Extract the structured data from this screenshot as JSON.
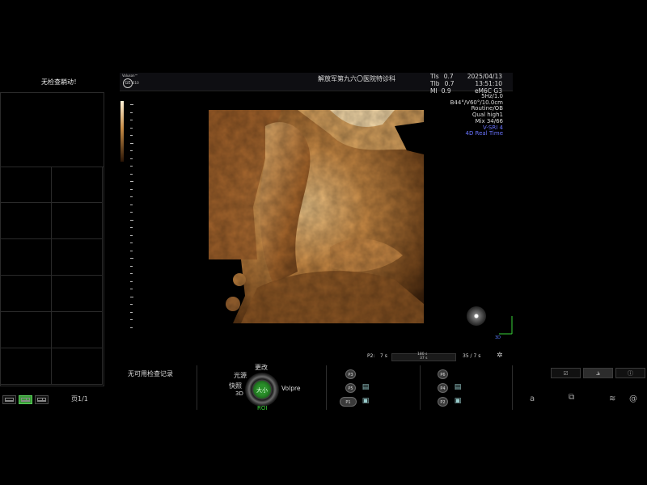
{
  "left_panel": {
    "title": "无检查耥动！",
    "page": "页1/1"
  },
  "header": {
    "brand_line": "Voluson™",
    "model_line": "E10",
    "ge_mark": "GE",
    "hospital": "解放军第九六〇医院特诊科",
    "safety": [
      {
        "label": "TIs",
        "value": "0.7"
      },
      {
        "label": "TIb",
        "value": "0.7"
      },
      {
        "label": "MI",
        "value": "0.9"
      }
    ],
    "date": "2025/04/13",
    "time": "13:51:10",
    "probe": "eM6C G3"
  },
  "params": {
    "freq": "5Hz/1.0",
    "angles": "B44°/V60°/10.0cm",
    "preset": "Routine/OB",
    "quality": "Qual high1",
    "mix": "Mix 34/66",
    "srii": "V-SRI 4",
    "mode": "4D Real Time"
  },
  "cine": {
    "p2": "P2:",
    "seconds": "7 s",
    "a": "180 s",
    "b": "37 s",
    "frames": "35 / 7 s"
  },
  "axes_label": "3D",
  "bottom": {
    "no_records": "无可用检查记录",
    "knob_top": "更改",
    "knob_tl": "光源",
    "knob_left": "快照",
    "knob_left2": "3D",
    "knob_right": "Volpre",
    "knob_bottom": "ROI",
    "knob_center": "大小",
    "p_buttons_1": [
      "P3",
      "P5",
      "P1"
    ],
    "p_buttons_2": [
      "P6",
      "P4",
      "P2"
    ]
  },
  "right_bottom": {
    "tab_icons": [
      "checklist-icon",
      "chart-icon",
      "info-icon"
    ],
    "sys_a": "a"
  },
  "colors": {
    "accent_green": "#3ad63a",
    "param_blue": "#6a74ff",
    "render_amber": "#c68b45"
  }
}
